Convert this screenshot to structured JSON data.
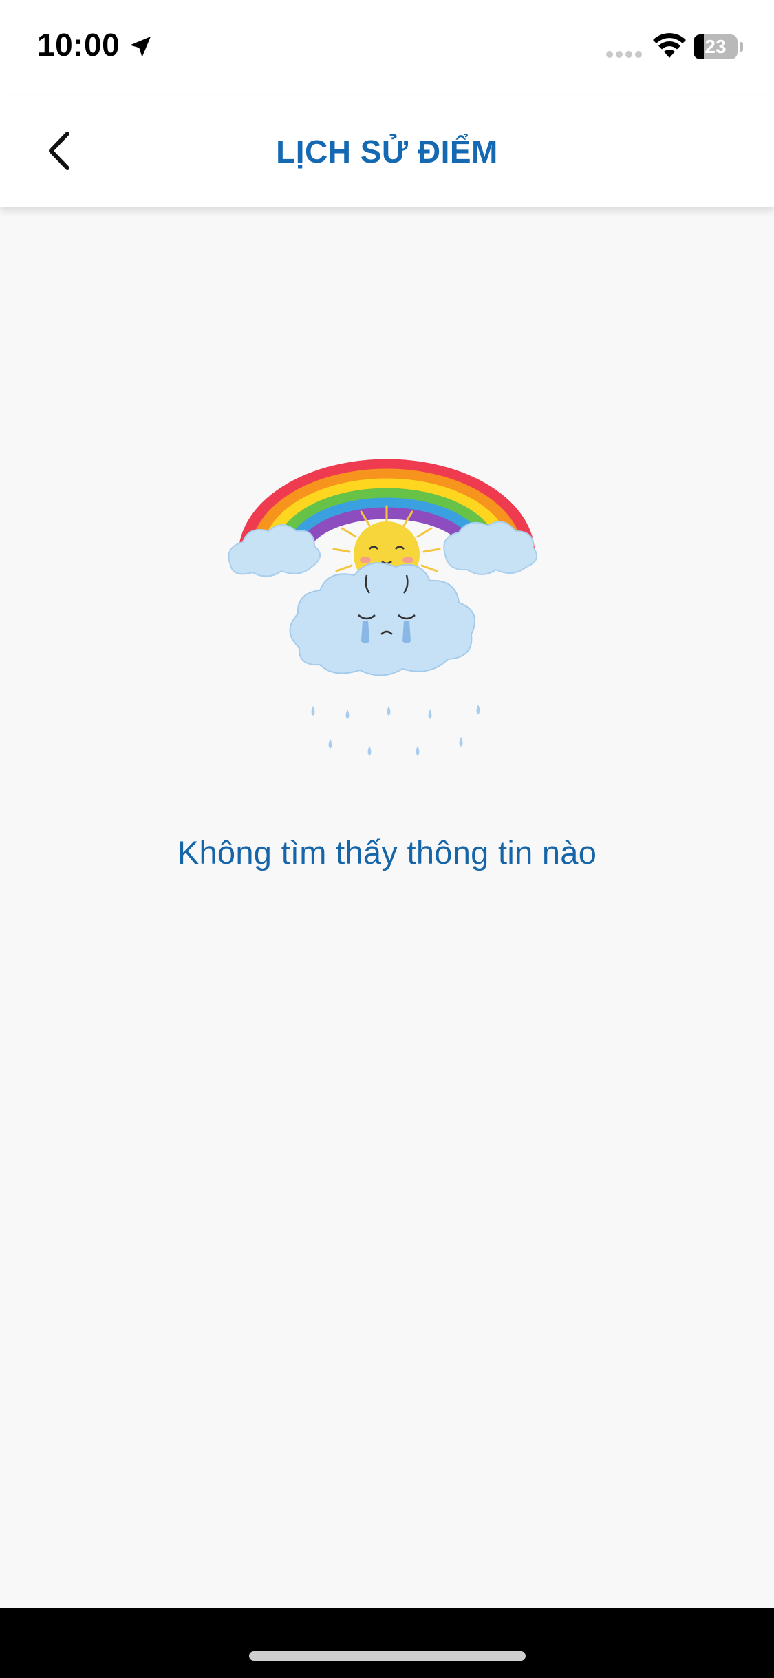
{
  "status_bar": {
    "time": "10:00",
    "battery": "23",
    "battery_level": 0.23,
    "icons": [
      "location-arrow-icon",
      "signal-icon",
      "wifi-icon",
      "battery-icon"
    ]
  },
  "header": {
    "title": "LỊCH SỬ ĐIỂM",
    "back_icon": "chevron-left-icon"
  },
  "empty_state": {
    "message": "Không tìm thấy thông tin nào",
    "illustration": "rainbow-sun-crying-cloud"
  },
  "colors": {
    "title": "#1569b3",
    "message": "#1565a8",
    "background": "#f8f8f8"
  }
}
